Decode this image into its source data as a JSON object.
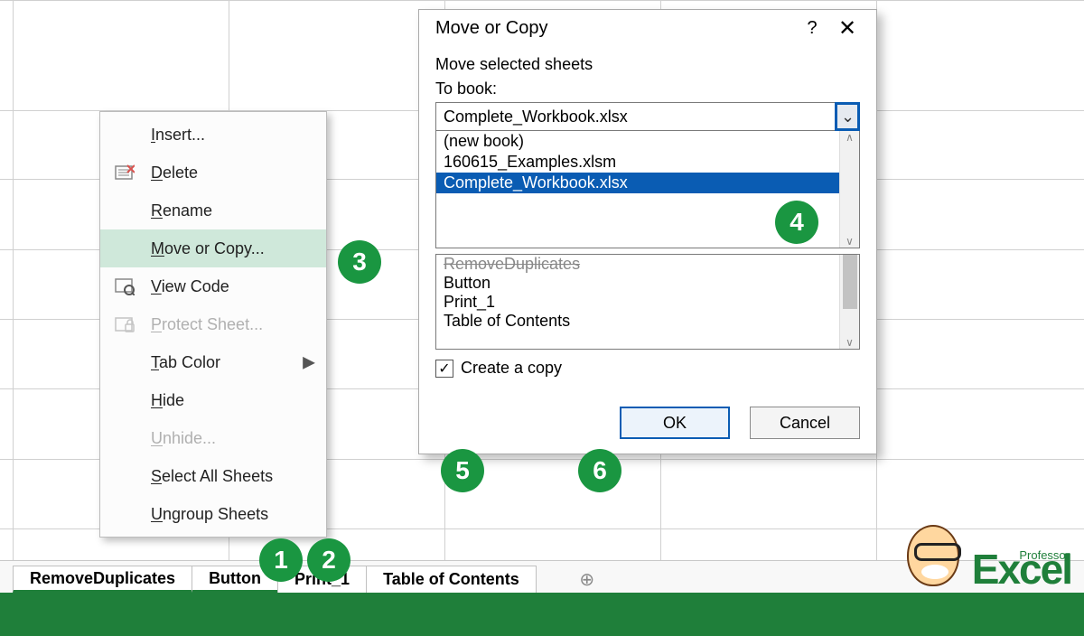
{
  "context_menu": {
    "items": [
      {
        "label": "Insert...",
        "u": "I"
      },
      {
        "label": "Delete",
        "u": "D"
      },
      {
        "label": "Rename",
        "u": "R"
      },
      {
        "label": "Move or Copy...",
        "u": "M"
      },
      {
        "label": "View Code",
        "u": "V"
      },
      {
        "label": "Protect Sheet...",
        "u": "P"
      },
      {
        "label": "Tab Color",
        "u": "T"
      },
      {
        "label": "Hide",
        "u": "H"
      },
      {
        "label": "Unhide...",
        "u": "U"
      },
      {
        "label": "Select All Sheets",
        "u": "S"
      },
      {
        "label": "Ungroup Sheets",
        "u": "U"
      }
    ]
  },
  "dialog": {
    "title": "Move or Copy",
    "heading1": "Move selected sheets",
    "heading2": "To book:",
    "selected_book": "Complete_Workbook.xlsx",
    "book_options": [
      "(new book)",
      "160615_Examples.xlsm",
      "Complete_Workbook.xlsx"
    ],
    "sheet_options": [
      "RemoveDuplicates",
      "Button",
      "Print_1",
      "Table of Contents"
    ],
    "checkbox_label": "Create a copy",
    "checkbox_u": "C",
    "ok": "OK",
    "cancel": "Cancel"
  },
  "tabs": [
    "RemoveDuplicates",
    "Button",
    "Print_1",
    "Table of Contents"
  ],
  "badges": [
    "1",
    "2",
    "3",
    "4",
    "5",
    "6"
  ],
  "logo": {
    "top": "Professor",
    "main": "Excel"
  }
}
